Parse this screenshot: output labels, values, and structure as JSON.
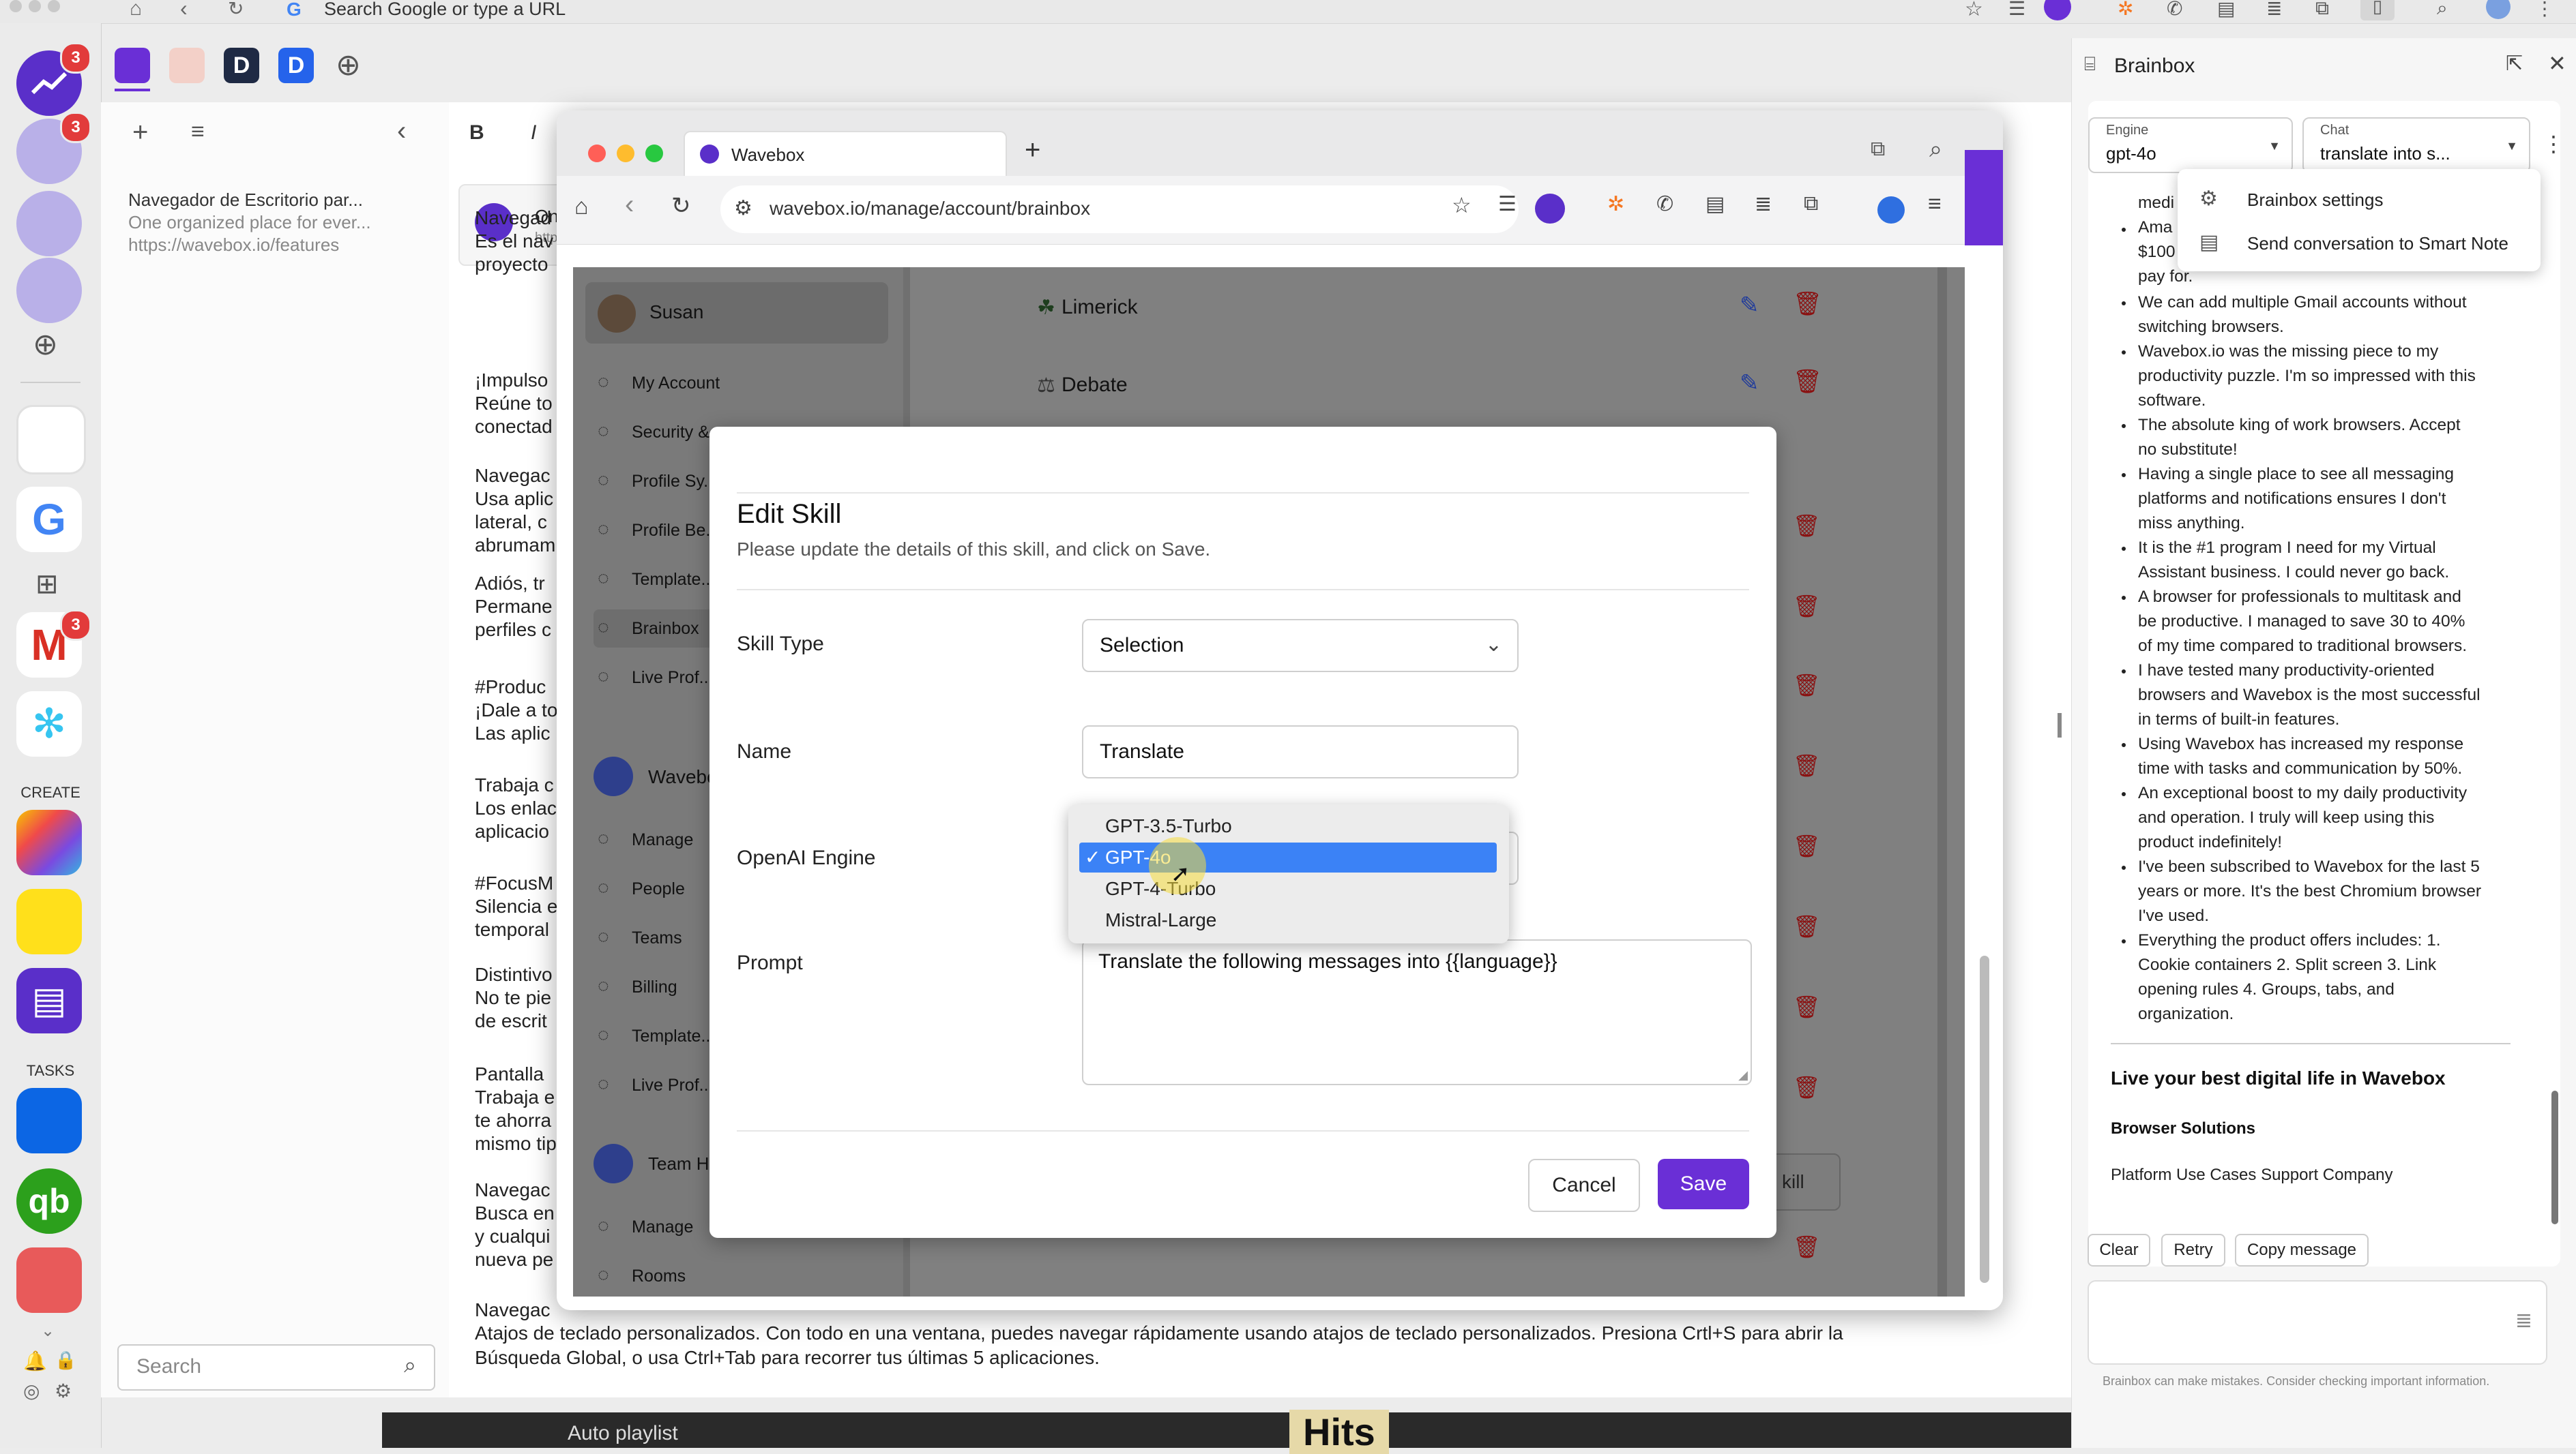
{
  "browser": {
    "url_placeholder": "Search Google or type a URL"
  },
  "dock": {
    "badges": {
      "analytics": "3",
      "mail_cluster": "3",
      "gmail": "3"
    },
    "section_create": "CREATE",
    "section_tasks": "TASKS"
  },
  "notes": {
    "item_title": "Navegador de Escritorio par...",
    "item_subtitle": "One organized place for ever...",
    "item_url": "https://wavebox.io/features",
    "search_placeholder": "Search"
  },
  "editor": {
    "toolbar_bold": "B",
    "toolbar_italic": "I",
    "header_title": "One",
    "header_sub": "https",
    "lines": [
      "Navegad",
      "Es el nav",
      "proyecto",
      "¡Impulso",
      "Reúne to",
      "conectad",
      "Navegac",
      "Usa aplic",
      "lateral, c",
      "abrumam",
      "Adiós, tr",
      "Permane",
      "perfiles c",
      "#Produc",
      "¡Dale a to",
      "Las aplic",
      "Trabaja c",
      "Los enlac",
      "aplicacio",
      "#FocusM",
      "Silencia e",
      "temporal",
      "Distintivo",
      "No te pie",
      "de escrit",
      "Pantalla",
      "Trabaja e",
      "te ahorra",
      "mismo tip",
      "Navegac",
      "Busca en",
      "y cualqui",
      "nueva pe"
    ],
    "bottom_line_1": "Navegac",
    "bottom_line_2": "Atajos de teclado personalizados. Con todo en una ventana, puedes navegar rápidamente usando atajos de teclado personalizados. Presiona Crtl+S para abrir la",
    "bottom_line_3": "Búsqueda Global, o usa Ctrl+Tab para recorrer tus últimas 5 aplicaciones.",
    "bottom_strip": "Auto playlist",
    "bottom_strip_2": "Hits"
  },
  "inner_window": {
    "tab_title": "Wavebox",
    "url": "wavebox.io/manage/account/brainbox",
    "sidebar": {
      "user": "Susan",
      "items": [
        "My Account",
        "Security & ...",
        "Profile Sy...",
        "Profile Be...",
        "Template...",
        "Brainbox",
        "Live Prof..."
      ],
      "section2_title": "Wavebo...",
      "items2": [
        "Manage",
        "People",
        "Teams",
        "Billing",
        "Template...",
        "Live Prof..."
      ],
      "section3_title": "Team H...",
      "items3": [
        "Manage",
        "Rooms"
      ]
    },
    "skills": [
      {
        "icon": "☘",
        "name": "Limerick"
      },
      {
        "icon": "⚖",
        "name": "Debate"
      }
    ],
    "partial_button": "kill"
  },
  "modal": {
    "title": "Edit Skill",
    "subtitle": "Please update the details of this skill, and click on Save.",
    "skill_type_label": "Skill Type",
    "skill_type_value": "Selection",
    "name_label": "Name",
    "name_value": "Translate",
    "engine_label": "OpenAI Engine",
    "prompt_label": "Prompt",
    "prompt_value": "Translate the following messages into {{language}}",
    "cancel": "Cancel",
    "save": "Save",
    "engine_options": [
      "GPT-3.5-Turbo",
      "GPT-4o",
      "GPT-4-Turbo",
      "Mistral-Large"
    ],
    "engine_selected": "GPT-4o",
    "check": "✓"
  },
  "brainbox": {
    "title": "Brainbox",
    "engine_label": "Engine",
    "engine_value": "gpt-4o",
    "chat_label": "Chat",
    "chat_value": "translate into s...",
    "menu": [
      "Brainbox settings",
      "Send conversation to Smart Note"
    ],
    "partial_lines": [
      "medi",
      "Ama",
      "$100",
      "pay for."
    ],
    "reviews": [
      [
        "We can add multiple Gmail accounts without",
        "switching browsers."
      ],
      [
        "Wavebox.io was the missing piece to my",
        "productivity puzzle. I'm so impressed with this",
        "software."
      ],
      [
        "The absolute king of work browsers. Accept",
        "no substitute!"
      ],
      [
        "Having a single place to see all messaging",
        "platforms and notifications ensures I don't",
        "miss anything."
      ],
      [
        "It is the #1 program I need for my Virtual",
        "Assistant business. I could never go back."
      ],
      [
        "A browser for professionals to multitask and",
        "be productive. I managed to save 30 to 40%",
        "of my time compared to traditional browsers."
      ],
      [
        "I have tested many productivity-oriented",
        "browsers and Wavebox is the most successful",
        "in terms of built-in features."
      ],
      [
        "Using Wavebox has increased my response",
        "time with tasks and communication by 50%."
      ],
      [
        "An exceptional boost to my daily productivity",
        "and operation. I truly will keep using this",
        "product indefinitely!"
      ],
      [
        "I've been subscribed to Wavebox for the last 5",
        "years or more. It's the best Chromium browser",
        "I've used."
      ],
      [
        "Everything the product offers includes: 1.",
        "Cookie containers 2. Split screen 3. Link",
        "opening rules 4. Groups, tabs, and",
        "organization."
      ]
    ],
    "heading": "Live your best digital life in Wavebox",
    "subheading": "Browser Solutions",
    "footer_links": "Platform Use Cases Support Company",
    "actions": [
      "Clear",
      "Retry",
      "Copy message"
    ],
    "disclaimer": "Brainbox can make mistakes. Consider checking important information."
  },
  "colors": {
    "accent": "#6a2fd6",
    "selected_blue": "#3b82f6",
    "brainbox_purple": "#5b2dcf"
  }
}
